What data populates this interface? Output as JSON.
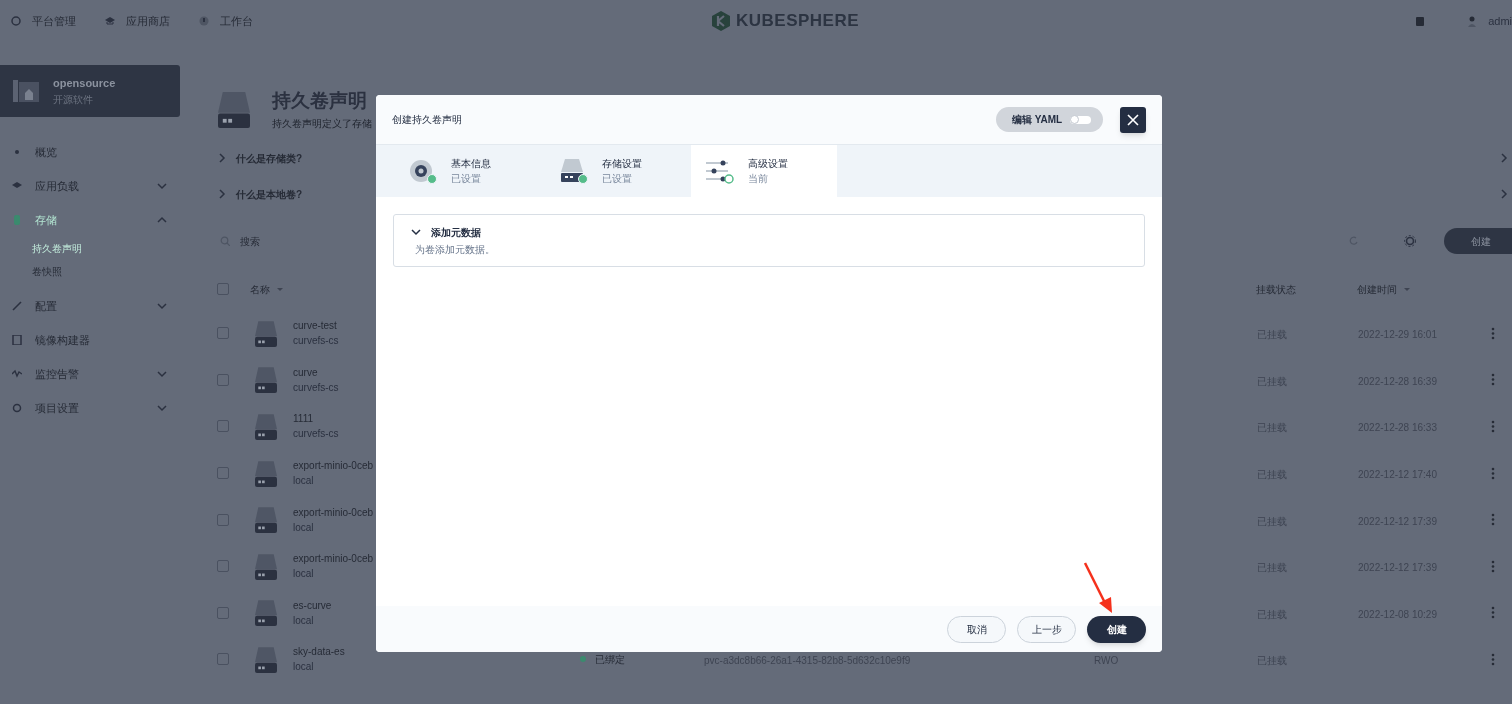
{
  "top_nav": [
    {
      "label": "平台管理"
    },
    {
      "label": "应用商店"
    },
    {
      "label": "工作台"
    }
  ],
  "logo": {
    "text": "KUBESPHERE"
  },
  "user": {
    "name": "admi"
  },
  "workspace": {
    "name": "opensource",
    "subtitle": "开源软件"
  },
  "sidebar": {
    "items": [
      {
        "label": "概览",
        "selected": false
      },
      {
        "label": "应用负载",
        "selected": false,
        "expanded": false
      },
      {
        "label": "存储",
        "selected": true,
        "expanded": true,
        "children": [
          {
            "label": "持久卷声明",
            "selected": true
          },
          {
            "label": "卷快照",
            "selected": false
          }
        ]
      },
      {
        "label": "配置",
        "selected": false,
        "expanded": false
      },
      {
        "label": "镜像构建器",
        "selected": false
      },
      {
        "label": "监控告警",
        "selected": false,
        "expanded": false
      },
      {
        "label": "项目设置",
        "selected": false,
        "expanded": false
      }
    ]
  },
  "page_header": {
    "title": "持久卷声明",
    "subtitle": "持久卷声明定义了存储"
  },
  "help": [
    "什么是存储类?",
    "什么是本地卷?"
  ],
  "toolbar": {
    "search_placeholder": "搜索",
    "create_button": "创建"
  },
  "table": {
    "select_all_checked": false,
    "columns": [
      {
        "label": "名称",
        "sortable": true
      },
      {
        "label": "挂载状态",
        "sortable": false
      },
      {
        "label": "创建时间",
        "sortable": true
      }
    ],
    "rows": [
      {
        "checked": false,
        "name": "curve-test",
        "storage_class": "curvefs-cs",
        "mount": "已挂载",
        "created": "2022-12-29 16:01"
      },
      {
        "checked": false,
        "name": "curve",
        "storage_class": "curvefs-cs",
        "mount": "已挂载",
        "created": "2022-12-28 16:39"
      },
      {
        "checked": false,
        "name": "1111",
        "storage_class": "curvefs-cs",
        "mount": "已挂载",
        "created": "2022-12-28 16:33"
      },
      {
        "checked": false,
        "name": "export-minio-0ceb",
        "storage_class": "local",
        "mount": "已挂载",
        "created": "2022-12-12 17:40"
      },
      {
        "checked": false,
        "name": "export-minio-0ceb",
        "storage_class": "local",
        "mount": "已挂载",
        "created": "2022-12-12 17:39"
      },
      {
        "checked": false,
        "name": "export-minio-0ceb",
        "storage_class": "local",
        "mount": "已挂载",
        "created": "2022-12-12 17:39"
      },
      {
        "checked": false,
        "name": "es-curve",
        "storage_class": "local",
        "mount": "已挂载",
        "created": "2022-12-08 10:29"
      },
      {
        "checked": false,
        "name": "sky-data-es",
        "storage_class": "local",
        "status": "已绑定",
        "color": "#3b8a6e",
        "volume": "pvc-a3dc8b66-26a1-4315-82b8-5d632c10e9f9",
        "access_mode": "RWO",
        "mount": "已挂载"
      }
    ]
  },
  "modal": {
    "title": "创建持久卷声明",
    "yaml_toggle": {
      "label": "编辑 YAML",
      "on": false
    },
    "steps": [
      {
        "kind": "disk",
        "title": "基本信息",
        "status_text": "已设置",
        "selected": false,
        "done": true
      },
      {
        "kind": "drive",
        "title": "存储设置",
        "status_text": "已设置",
        "selected": false,
        "done": true
      },
      {
        "kind": "sliders",
        "title": "高级设置",
        "status_text": "当前",
        "selected": true,
        "done": false
      }
    ],
    "sections": [
      {
        "title": "添加元数据",
        "description": "为卷添加元数据。"
      }
    ],
    "buttons": [
      {
        "label": "取消",
        "kind": "secondary"
      },
      {
        "label": "上一步",
        "kind": "secondary"
      },
      {
        "label": "创建",
        "kind": "primary"
      }
    ]
  }
}
